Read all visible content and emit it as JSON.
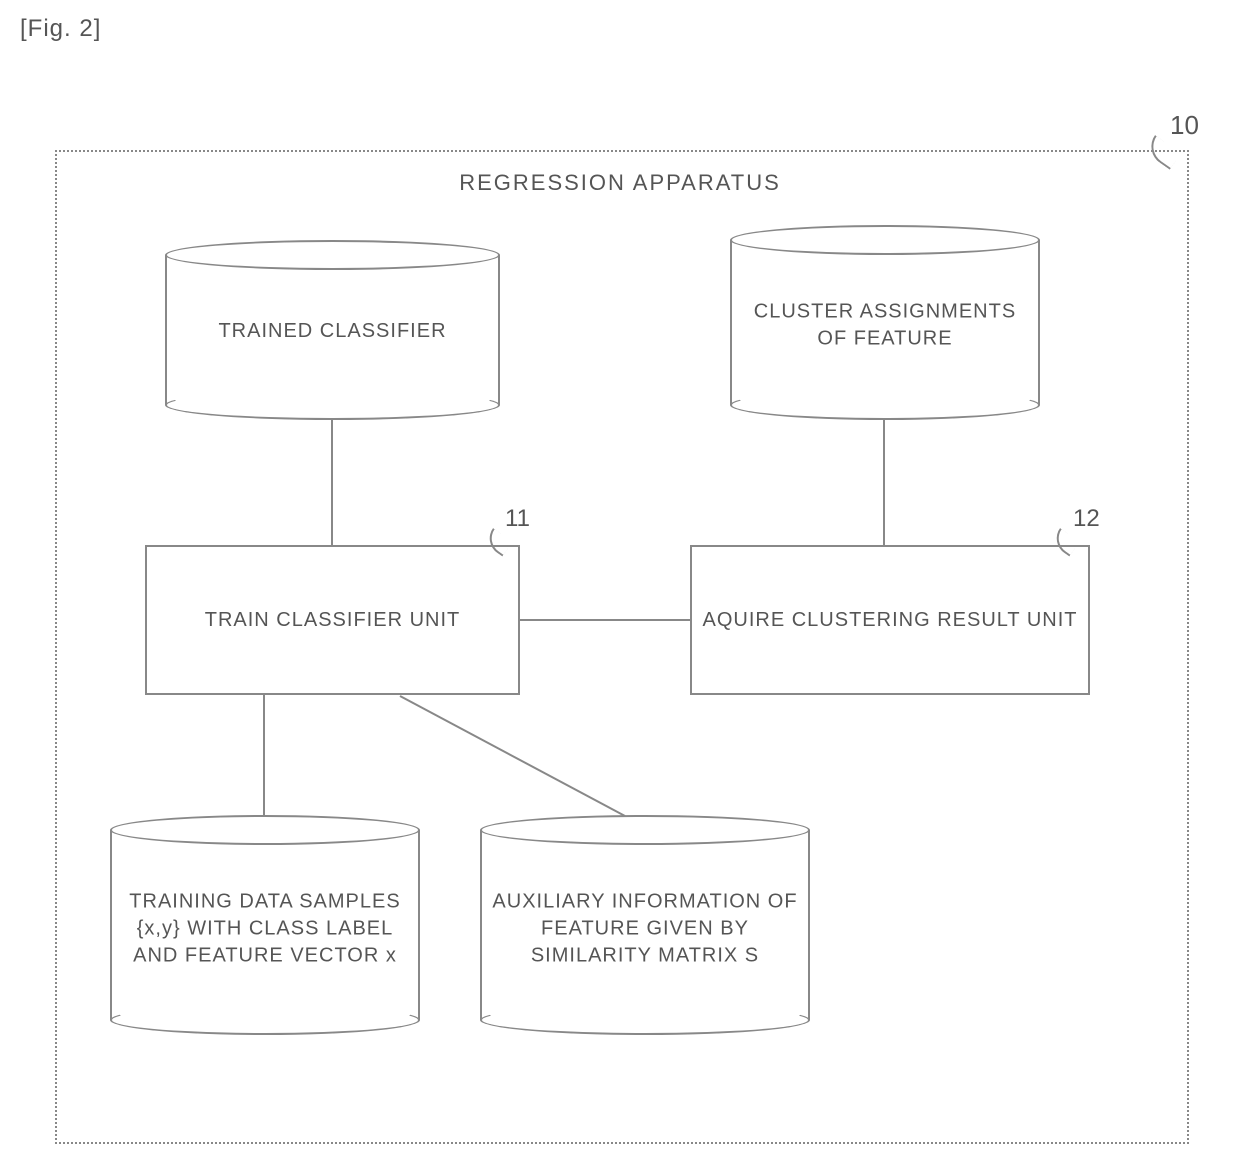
{
  "figure": {
    "label": "[Fig. 2]",
    "apparatus_ref": "10",
    "apparatus_title": "REGRESSION APPARATUS"
  },
  "stores": {
    "trained_classifier": "TRAINED CLASSIFIER",
    "cluster_assignments": "CLUSTER\nASSIGNMENTS OF\nFEATURE",
    "training_samples": "TRAINING DATA\nSAMPLES {x,y} WITH\nCLASS LABEL AND\nFEATURE VECTOR x",
    "auxiliary_info": "AUXILIARY\nINFORMATION OF\nFEATURE GIVEN BY\nSIMILARITY MATRIX S"
  },
  "units": {
    "train": {
      "label": "TRAIN CLASSIFIER UNIT",
      "ref": "11"
    },
    "acquire": {
      "label": "AQUIRE CLUSTERING RESULT\nUNIT",
      "ref": "12"
    }
  }
}
